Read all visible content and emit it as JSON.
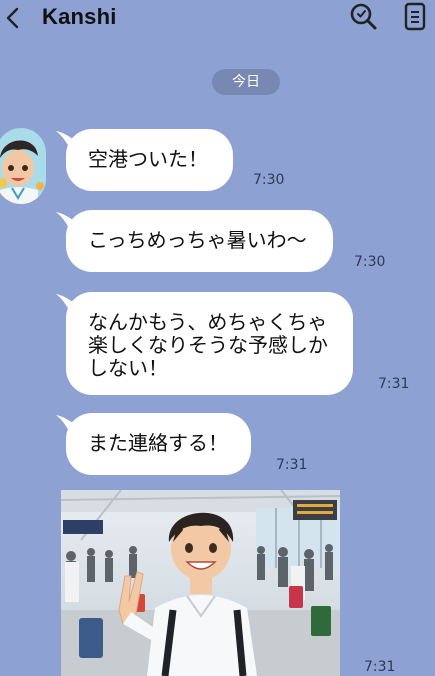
{
  "header": {
    "title": "Kanshi",
    "back_icon": "chevron-left-icon",
    "search_icon": "search-icon",
    "menu_icon": "menu-list-icon"
  },
  "date_separator": "今日",
  "messages": [
    {
      "text": "空港ついた！",
      "time": "7:30"
    },
    {
      "text": "こっちめっちゃ暑いわ〜",
      "time": "7:30"
    },
    {
      "text": "なんかもう、めちゃくちゃ\n楽しくなりそうな予感しか\nしない！",
      "time": "7:31"
    },
    {
      "text": "また連絡する！",
      "time": "7:31"
    },
    {
      "image": "airport-selfie-photo",
      "time": "7:31"
    }
  ],
  "colors": {
    "background": "#8da2d2",
    "bubble": "#ffffff",
    "date_pill": "#7788b3"
  }
}
